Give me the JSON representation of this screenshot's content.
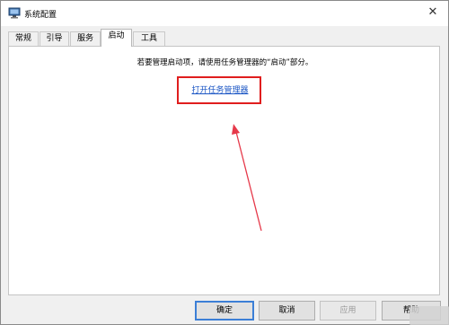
{
  "window": {
    "title": "系统配置",
    "close_glyph": "✕"
  },
  "tabs": [
    {
      "label": "常规"
    },
    {
      "label": "引导"
    },
    {
      "label": "服务"
    },
    {
      "label": "启动",
      "active": true
    },
    {
      "label": "工具"
    }
  ],
  "startup_panel": {
    "info_text": "若要管理启动项，请使用任务管理器的“启动”部分。",
    "task_manager_link": "打开任务管理器"
  },
  "buttons": {
    "ok": "确定",
    "cancel": "取消",
    "apply": "应用",
    "help": "帮助"
  },
  "annotation": {
    "highlight_color": "#e01e1e"
  }
}
